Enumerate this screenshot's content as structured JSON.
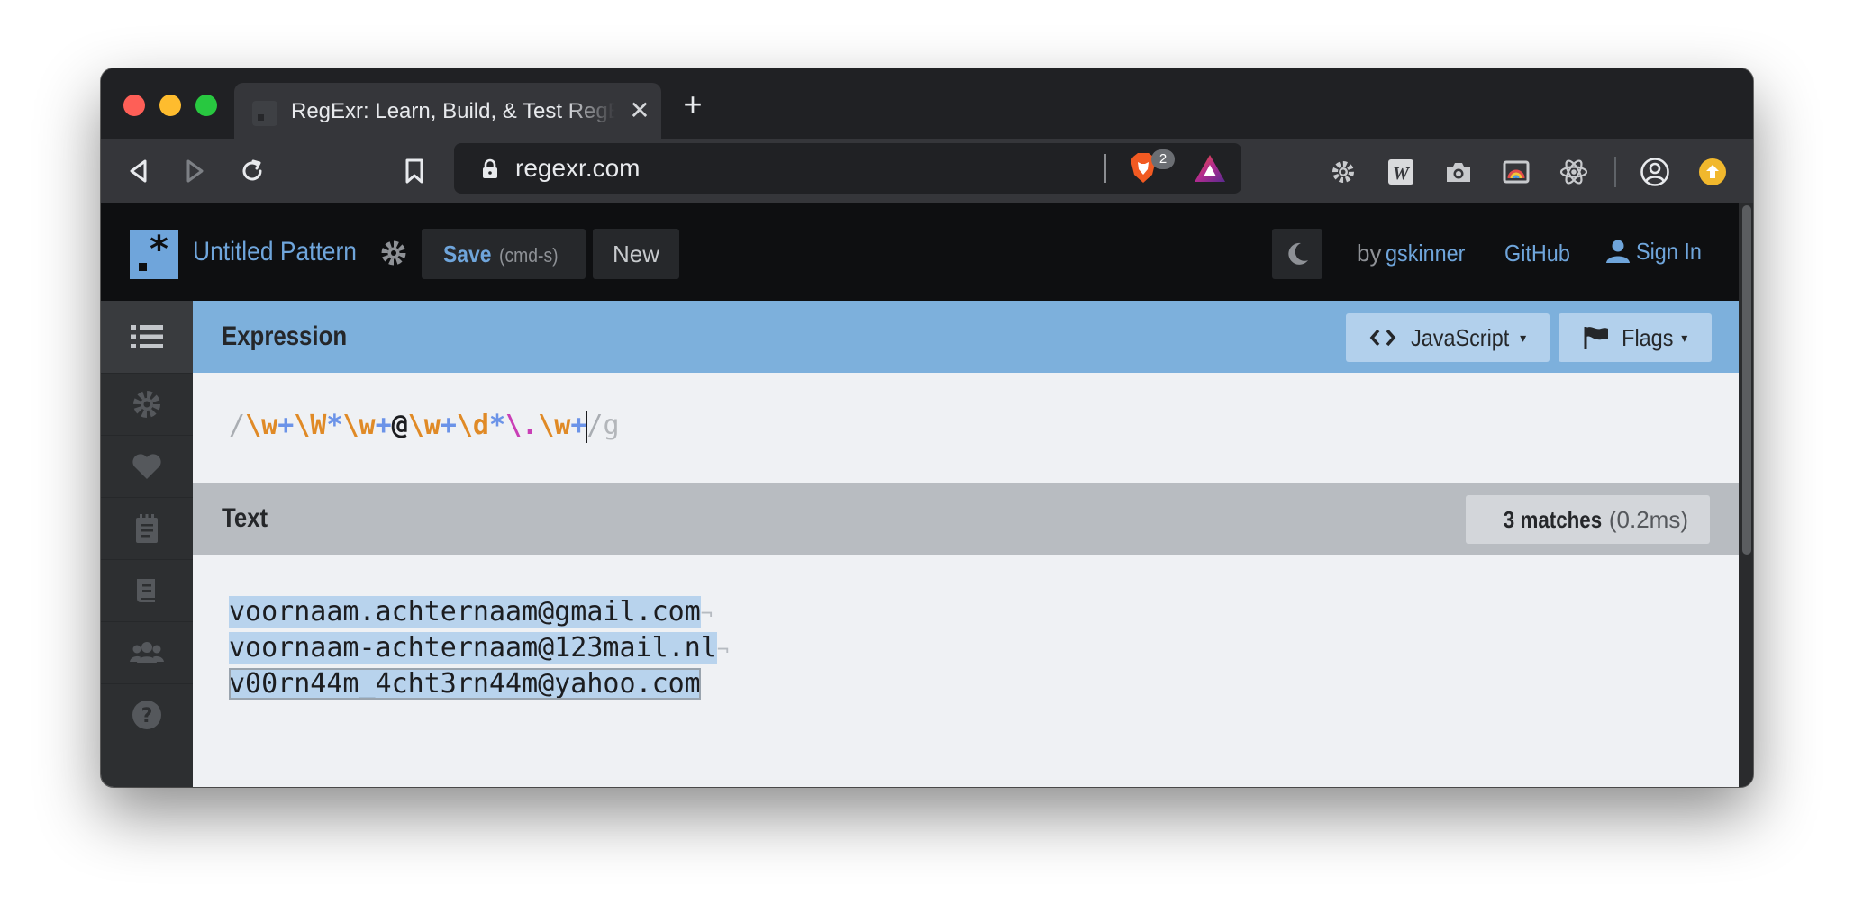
{
  "browser": {
    "tab_title": "RegExr: Learn, Build, & Test RegEx",
    "tab_close": "✕",
    "new_tab": "+",
    "url": "regexr.com",
    "shield_count": "2"
  },
  "header": {
    "pattern_name": "Untitled Pattern",
    "save_label": "Save",
    "save_hint": "(cmd-s)",
    "new_label": "New",
    "by_label": "by",
    "author": "gskinner",
    "github_label": "GitHub",
    "signin_label": "Sign In"
  },
  "sidebar": {
    "items": [
      "menu-icon",
      "settings-icon",
      "favorites-icon",
      "cheatsheet-icon",
      "reference-icon",
      "community-icon",
      "help-icon"
    ]
  },
  "expression": {
    "title": "Expression",
    "flavor_label": "JavaScript",
    "flags_label": "Flags",
    "caret": "▾",
    "open_delimiter": "/",
    "tokens": [
      {
        "text": "\\w",
        "kind": "class"
      },
      {
        "text": "+",
        "kind": "quant"
      },
      {
        "text": "\\W",
        "kind": "class"
      },
      {
        "text": "*",
        "kind": "quant"
      },
      {
        "text": "\\w",
        "kind": "class"
      },
      {
        "text": "+",
        "kind": "quant"
      },
      {
        "text": "@",
        "kind": "lit"
      },
      {
        "text": "\\w",
        "kind": "class"
      },
      {
        "text": "+",
        "kind": "quant"
      },
      {
        "text": "\\d",
        "kind": "class"
      },
      {
        "text": "*",
        "kind": "quant"
      },
      {
        "text": "\\.",
        "kind": "esc"
      },
      {
        "text": "\\w",
        "kind": "class"
      },
      {
        "text": "+",
        "kind": "quant"
      }
    ],
    "close_delimiter": "/",
    "flags": "g"
  },
  "text": {
    "title": "Text",
    "match_count": "3 matches",
    "match_time": "(0.2ms)",
    "newline_marker": "¬",
    "lines": [
      "voornaam.achternaam@gmail.com",
      "voornaam-achternaam@123mail.nl",
      "v00rn44m_4cht3rn44m@yahoo.com"
    ]
  },
  "colors": {
    "accent": "#6fa5db",
    "expression_header": "#7db0dc",
    "text_header": "#b8bcc1",
    "match_highlight": "#b8d3ed",
    "token_class": "#e08a26",
    "token_quantifier": "#6b93e8",
    "token_escape": "#c93fb6"
  }
}
